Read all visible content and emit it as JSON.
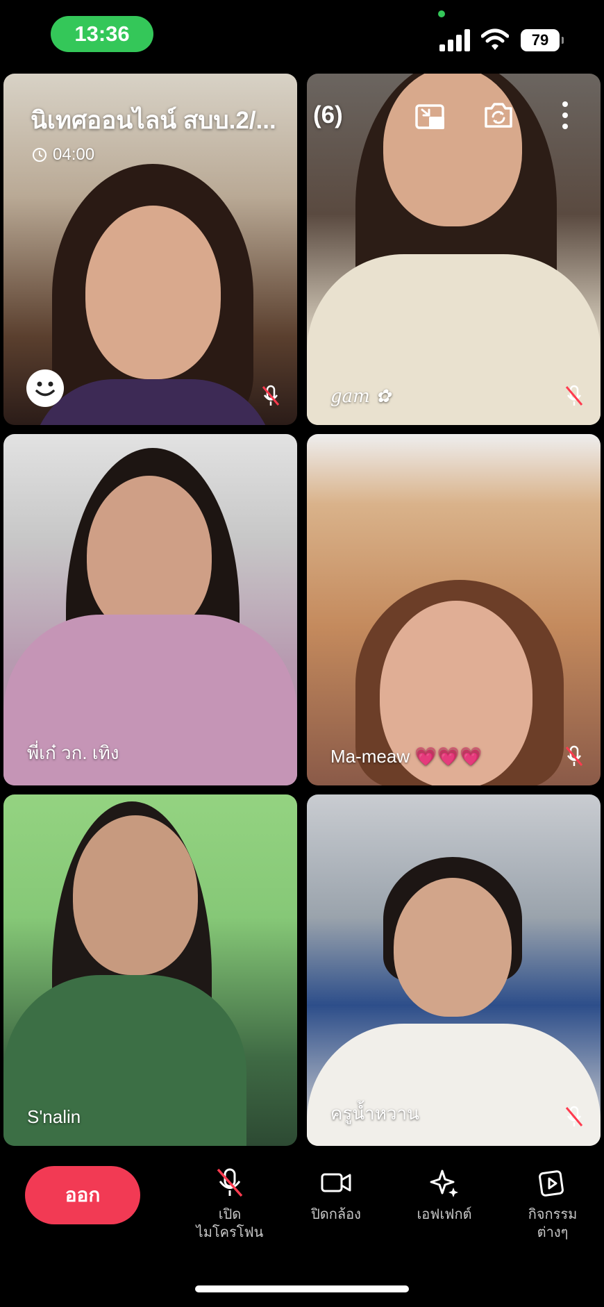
{
  "status_bar": {
    "time": "13:36",
    "battery": "79"
  },
  "meeting": {
    "title": "นิเทศออนไลน์ สบบ.2/...",
    "participant_count": "(6)",
    "duration": "04:00"
  },
  "participants": [
    {
      "name": ""
    },
    {
      "name": "gam ✿"
    },
    {
      "name": "พี่เก๋ วก. เทิง"
    },
    {
      "name": "Ma-meaw 💗💗💗"
    },
    {
      "name": "S'nalin"
    },
    {
      "name": "ครูน้ำหวาน"
    }
  ],
  "controls": {
    "leave": "ออก",
    "mic": "เปิด\nไมโครโฟน",
    "camera": "ปิดกล้อง",
    "effects": "เอฟเฟกต์",
    "activities": "กิจกรรม\nต่างๆ"
  },
  "colors": {
    "leave_button": "#f23a54",
    "status_pill": "#34c759"
  }
}
